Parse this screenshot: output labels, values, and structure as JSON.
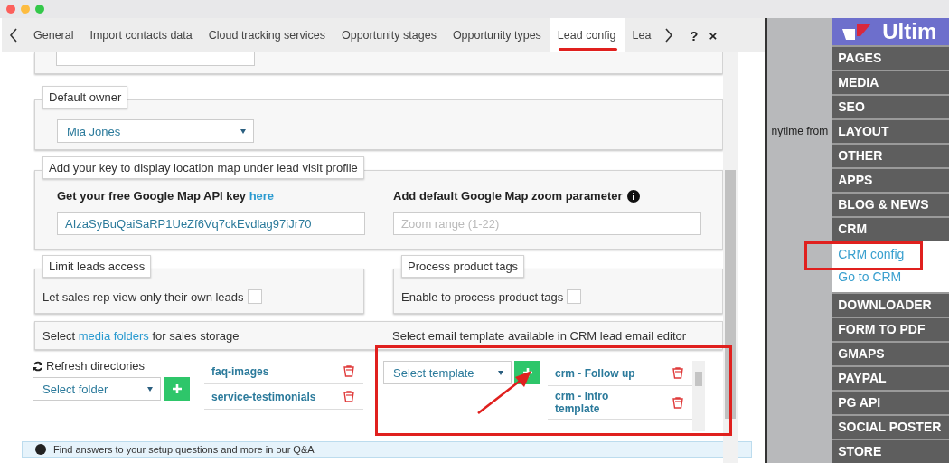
{
  "tabs": [
    {
      "label": "General",
      "selected": false
    },
    {
      "label": "Import contacts data",
      "selected": false
    },
    {
      "label": "Cloud tracking services",
      "selected": false
    },
    {
      "label": "Opportunity stages",
      "selected": false
    },
    {
      "label": "Opportunity types",
      "selected": false
    },
    {
      "label": "Lead config",
      "selected": true
    },
    {
      "label": "Lea",
      "selected": false
    }
  ],
  "dialog_controls": {
    "help": "?",
    "close": "×"
  },
  "default_owner": {
    "legend": "Default owner",
    "value": "Mia Jones"
  },
  "map": {
    "legend": "Add your key to display location map under lead visit profile",
    "api_label": "Get your free Google Map API key",
    "api_link": "here",
    "api_value": "AIzaSyBuQaiSaRP1UeZf6Vq7ckEvdlag97iJr70",
    "zoom_label": "Add default Google Map zoom parameter",
    "zoom_placeholder": "Zoom range (1-22)"
  },
  "limit_leads": {
    "legend": "Limit leads access",
    "label": "Let sales rep view only their own leads",
    "checked": false
  },
  "product_tags": {
    "legend": "Process product tags",
    "label": "Enable to process product tags",
    "checked": false
  },
  "media": {
    "text_before": "Select",
    "link": "media folders",
    "text_after": "for sales storage",
    "refresh": "Refresh directories",
    "select_value": "Select folder",
    "folders": [
      "faq-images",
      "service-testimonials"
    ]
  },
  "templates": {
    "heading": "Select email template available in CRM lead email editor",
    "select_value": "Select template",
    "items": [
      "crm - Follow up",
      "crm - Intro template"
    ]
  },
  "qa_bar": {
    "text": "Find answers to your setup questions and more in our Q&A"
  },
  "background_text": "nytime from",
  "menu": {
    "logo_text": "Ultim",
    "items": [
      {
        "label": "PAGES"
      },
      {
        "label": "MEDIA"
      },
      {
        "label": "SEO"
      },
      {
        "label": "LAYOUT"
      },
      {
        "label": "OTHER"
      },
      {
        "label": "APPS"
      },
      {
        "label": "BLOG & NEWS"
      },
      {
        "label": "CRM",
        "children": [
          {
            "label": "CRM config"
          },
          {
            "label": "Go to CRM"
          }
        ]
      },
      {
        "label": "DOWNLOADER"
      },
      {
        "label": "FORM TO PDF"
      },
      {
        "label": "GMAPS"
      },
      {
        "label": "PAYPAL"
      },
      {
        "label": "PG API"
      },
      {
        "label": "SOCIAL POSTER"
      },
      {
        "label": "STORE"
      }
    ]
  }
}
